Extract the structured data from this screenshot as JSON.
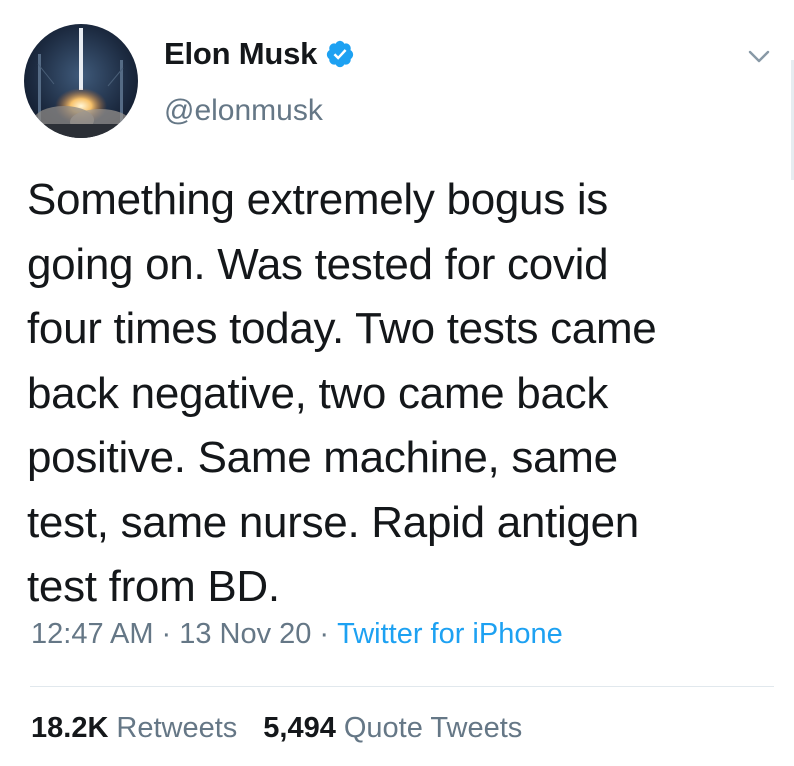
{
  "author": {
    "display_name": "Elon Musk",
    "handle": "@elonmusk",
    "verified": true,
    "avatar_icon": "rocket-launch-avatar"
  },
  "tweet": {
    "text": "Something extremely bogus is\ngoing on. Was tested for covid\nfour times today. Two tests came\nback negative, two came back\npositive. Same machine, same\ntest, same nurse. Rapid antigen\ntest from BD.",
    "time": "12:47 AM",
    "date": "13 Nov 20",
    "separator": "·",
    "source": "Twitter for iPhone"
  },
  "stats": {
    "retweets_count": "18.2K",
    "retweets_label": "Retweets",
    "quote_tweets_count": "5,494",
    "quote_tweets_label": "Quote Tweets"
  },
  "colors": {
    "text_primary": "#14171a",
    "text_secondary": "#657786",
    "accent": "#1da1f2",
    "divider": "#e1e8ed"
  },
  "icons": {
    "verified": "verified-badge-icon",
    "menu": "chevron-down-icon"
  }
}
